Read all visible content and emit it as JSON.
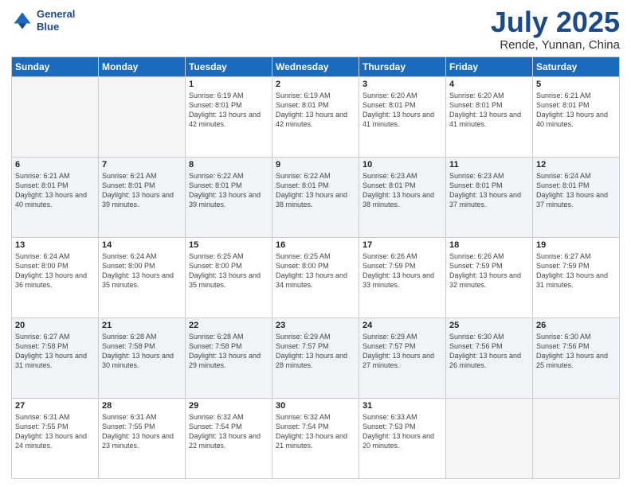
{
  "header": {
    "logo_line1": "General",
    "logo_line2": "Blue",
    "month": "July 2025",
    "location": "Rende, Yunnan, China"
  },
  "days_of_week": [
    "Sunday",
    "Monday",
    "Tuesday",
    "Wednesday",
    "Thursday",
    "Friday",
    "Saturday"
  ],
  "weeks": [
    [
      {
        "day": "",
        "info": ""
      },
      {
        "day": "",
        "info": ""
      },
      {
        "day": "1",
        "info": "Sunrise: 6:19 AM\nSunset: 8:01 PM\nDaylight: 13 hours\nand 42 minutes."
      },
      {
        "day": "2",
        "info": "Sunrise: 6:19 AM\nSunset: 8:01 PM\nDaylight: 13 hours\nand 42 minutes."
      },
      {
        "day": "3",
        "info": "Sunrise: 6:20 AM\nSunset: 8:01 PM\nDaylight: 13 hours\nand 41 minutes."
      },
      {
        "day": "4",
        "info": "Sunrise: 6:20 AM\nSunset: 8:01 PM\nDaylight: 13 hours\nand 41 minutes."
      },
      {
        "day": "5",
        "info": "Sunrise: 6:21 AM\nSunset: 8:01 PM\nDaylight: 13 hours\nand 40 minutes."
      }
    ],
    [
      {
        "day": "6",
        "info": "Sunrise: 6:21 AM\nSunset: 8:01 PM\nDaylight: 13 hours\nand 40 minutes."
      },
      {
        "day": "7",
        "info": "Sunrise: 6:21 AM\nSunset: 8:01 PM\nDaylight: 13 hours\nand 39 minutes."
      },
      {
        "day": "8",
        "info": "Sunrise: 6:22 AM\nSunset: 8:01 PM\nDaylight: 13 hours\nand 39 minutes."
      },
      {
        "day": "9",
        "info": "Sunrise: 6:22 AM\nSunset: 8:01 PM\nDaylight: 13 hours\nand 38 minutes."
      },
      {
        "day": "10",
        "info": "Sunrise: 6:23 AM\nSunset: 8:01 PM\nDaylight: 13 hours\nand 38 minutes."
      },
      {
        "day": "11",
        "info": "Sunrise: 6:23 AM\nSunset: 8:01 PM\nDaylight: 13 hours\nand 37 minutes."
      },
      {
        "day": "12",
        "info": "Sunrise: 6:24 AM\nSunset: 8:01 PM\nDaylight: 13 hours\nand 37 minutes."
      }
    ],
    [
      {
        "day": "13",
        "info": "Sunrise: 6:24 AM\nSunset: 8:00 PM\nDaylight: 13 hours\nand 36 minutes."
      },
      {
        "day": "14",
        "info": "Sunrise: 6:24 AM\nSunset: 8:00 PM\nDaylight: 13 hours\nand 35 minutes."
      },
      {
        "day": "15",
        "info": "Sunrise: 6:25 AM\nSunset: 8:00 PM\nDaylight: 13 hours\nand 35 minutes."
      },
      {
        "day": "16",
        "info": "Sunrise: 6:25 AM\nSunset: 8:00 PM\nDaylight: 13 hours\nand 34 minutes."
      },
      {
        "day": "17",
        "info": "Sunrise: 6:26 AM\nSunset: 7:59 PM\nDaylight: 13 hours\nand 33 minutes."
      },
      {
        "day": "18",
        "info": "Sunrise: 6:26 AM\nSunset: 7:59 PM\nDaylight: 13 hours\nand 32 minutes."
      },
      {
        "day": "19",
        "info": "Sunrise: 6:27 AM\nSunset: 7:59 PM\nDaylight: 13 hours\nand 31 minutes."
      }
    ],
    [
      {
        "day": "20",
        "info": "Sunrise: 6:27 AM\nSunset: 7:58 PM\nDaylight: 13 hours\nand 31 minutes."
      },
      {
        "day": "21",
        "info": "Sunrise: 6:28 AM\nSunset: 7:58 PM\nDaylight: 13 hours\nand 30 minutes."
      },
      {
        "day": "22",
        "info": "Sunrise: 6:28 AM\nSunset: 7:58 PM\nDaylight: 13 hours\nand 29 minutes."
      },
      {
        "day": "23",
        "info": "Sunrise: 6:29 AM\nSunset: 7:57 PM\nDaylight: 13 hours\nand 28 minutes."
      },
      {
        "day": "24",
        "info": "Sunrise: 6:29 AM\nSunset: 7:57 PM\nDaylight: 13 hours\nand 27 minutes."
      },
      {
        "day": "25",
        "info": "Sunrise: 6:30 AM\nSunset: 7:56 PM\nDaylight: 13 hours\nand 26 minutes."
      },
      {
        "day": "26",
        "info": "Sunrise: 6:30 AM\nSunset: 7:56 PM\nDaylight: 13 hours\nand 25 minutes."
      }
    ],
    [
      {
        "day": "27",
        "info": "Sunrise: 6:31 AM\nSunset: 7:55 PM\nDaylight: 13 hours\nand 24 minutes."
      },
      {
        "day": "28",
        "info": "Sunrise: 6:31 AM\nSunset: 7:55 PM\nDaylight: 13 hours\nand 23 minutes."
      },
      {
        "day": "29",
        "info": "Sunrise: 6:32 AM\nSunset: 7:54 PM\nDaylight: 13 hours\nand 22 minutes."
      },
      {
        "day": "30",
        "info": "Sunrise: 6:32 AM\nSunset: 7:54 PM\nDaylight: 13 hours\nand 21 minutes."
      },
      {
        "day": "31",
        "info": "Sunrise: 6:33 AM\nSunset: 7:53 PM\nDaylight: 13 hours\nand 20 minutes."
      },
      {
        "day": "",
        "info": ""
      },
      {
        "day": "",
        "info": ""
      }
    ]
  ]
}
